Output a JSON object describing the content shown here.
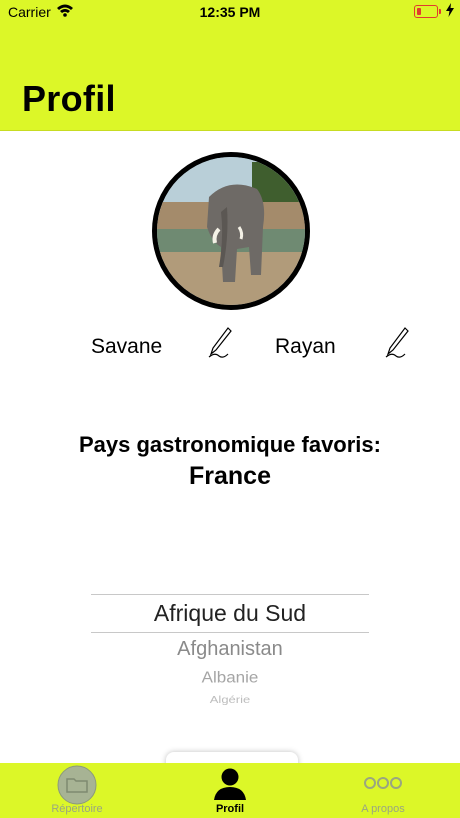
{
  "status_bar": {
    "carrier": "Carrier",
    "time": "12:35 PM",
    "battery_color": "#e13b2d"
  },
  "header": {
    "title": "Profil",
    "background": "#dcf728"
  },
  "profile": {
    "avatar_icon": "elephant-photo",
    "last_name": "Savane",
    "first_name": "Rayan",
    "edit_icon": "pencil-icon"
  },
  "favorite": {
    "title": "Pays gastronomique favoris:",
    "value": "France"
  },
  "picker": {
    "selected": "Afrique du Sud",
    "options": [
      "Afghanistan",
      "Albanie",
      "Algérie"
    ]
  },
  "tabs": [
    {
      "label": "Répertoire",
      "icon": "folder-icon",
      "active": false
    },
    {
      "label": "Profil",
      "icon": "person-icon",
      "active": true
    },
    {
      "label": "A propos",
      "icon": "more-icon",
      "active": false
    }
  ]
}
